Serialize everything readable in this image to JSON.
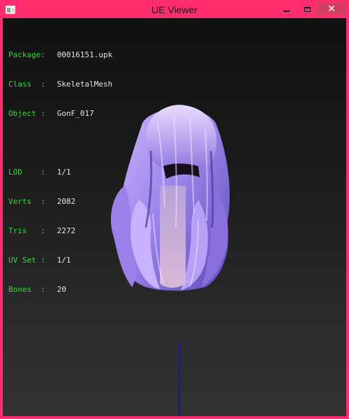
{
  "window": {
    "title": "UE Viewer",
    "close_label": "✕"
  },
  "colors": {
    "frame": "#ff2d6e",
    "label": "#39d839",
    "value": "#e6e6e6",
    "axis": "#1616a8"
  },
  "info": {
    "package": {
      "label": "Package:",
      "value": "00016151.upk"
    },
    "class": {
      "label": "Class  :",
      "value": "SkeletalMesh"
    },
    "object": {
      "label": "Object :",
      "value": "GonF_017"
    },
    "lod": {
      "label": "LOD    :",
      "value": "1/1"
    },
    "verts": {
      "label": "Verts  :",
      "value": "2082"
    },
    "tris": {
      "label": "Tris   :",
      "value": "2272"
    },
    "uvset": {
      "label": "UV Set :",
      "value": "1/1"
    },
    "bones": {
      "label": "Bones  :",
      "value": "20"
    }
  }
}
